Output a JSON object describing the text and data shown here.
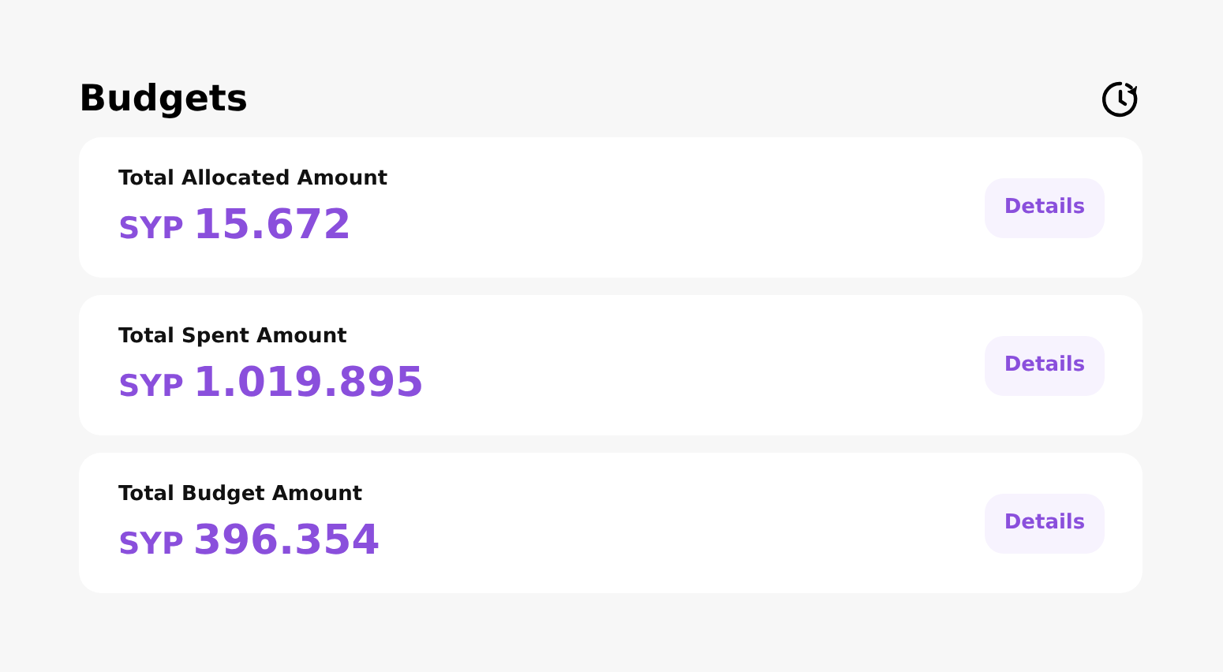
{
  "header": {
    "title": "Budgets"
  },
  "cards": [
    {
      "label": "Total Allocated Amount",
      "currency": "SYP",
      "amount": "15.672",
      "button": "Details"
    },
    {
      "label": "Total Spent Amount",
      "currency": "SYP",
      "amount": "1.019.895",
      "button": "Details"
    },
    {
      "label": "Total Budget Amount",
      "currency": "SYP",
      "amount": "396.354",
      "button": "Details"
    }
  ]
}
